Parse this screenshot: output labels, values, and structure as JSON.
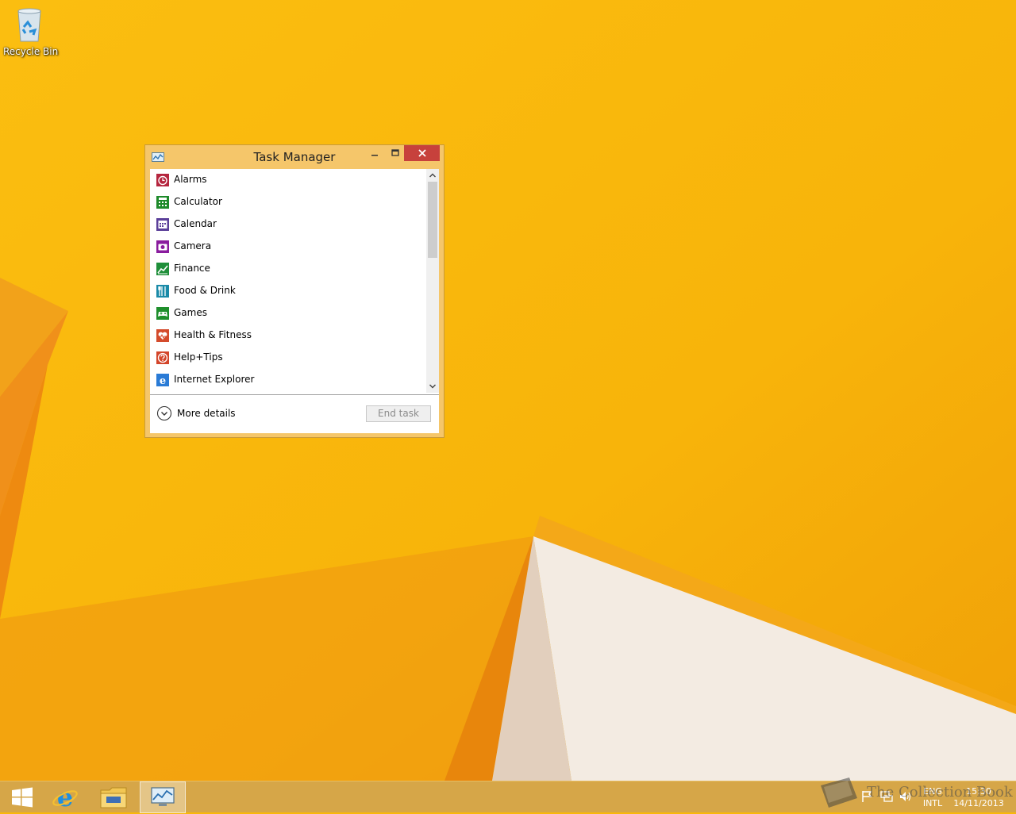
{
  "desktop": {
    "icons": [
      {
        "label": "Recycle Bin",
        "icon": "recycle-bin-icon"
      }
    ]
  },
  "task_manager": {
    "title": "Task Manager",
    "apps": [
      {
        "name": "Alarms",
        "icon": "alarm-clock-icon",
        "color": "#b5263f"
      },
      {
        "name": "Calculator",
        "icon": "calculator-icon",
        "color": "#1e8a2a"
      },
      {
        "name": "Calendar",
        "icon": "calendar-icon",
        "color": "#5b3f99"
      },
      {
        "name": "Camera",
        "icon": "camera-icon",
        "color": "#8a1c9e"
      },
      {
        "name": "Finance",
        "icon": "finance-chart-icon",
        "color": "#1f8f3a"
      },
      {
        "name": "Food & Drink",
        "icon": "utensils-icon",
        "color": "#1a8aa8"
      },
      {
        "name": "Games",
        "icon": "gamepad-icon",
        "color": "#1f8f2c"
      },
      {
        "name": "Health & Fitness",
        "icon": "heart-pulse-icon",
        "color": "#d44b2c"
      },
      {
        "name": "Help+Tips",
        "icon": "help-icon",
        "color": "#d3452a"
      },
      {
        "name": "Internet Explorer",
        "icon": "internet-explorer-icon",
        "color": "#2a7bd6"
      }
    ],
    "more_details_label": "More details",
    "end_task_label": "End task"
  },
  "taskbar": {
    "items": [
      {
        "name": "start",
        "icon": "windows-logo-icon"
      },
      {
        "name": "internet-explorer",
        "icon": "internet-explorer-icon"
      },
      {
        "name": "file-explorer",
        "icon": "folder-icon"
      },
      {
        "name": "task-manager",
        "icon": "task-manager-icon",
        "active": true
      }
    ],
    "language": {
      "line1": "ENG",
      "line2": "INTL"
    },
    "clock": {
      "time": "15:30",
      "date": "14/11/2013"
    }
  },
  "watermark": {
    "text": "The Collection Book"
  }
}
